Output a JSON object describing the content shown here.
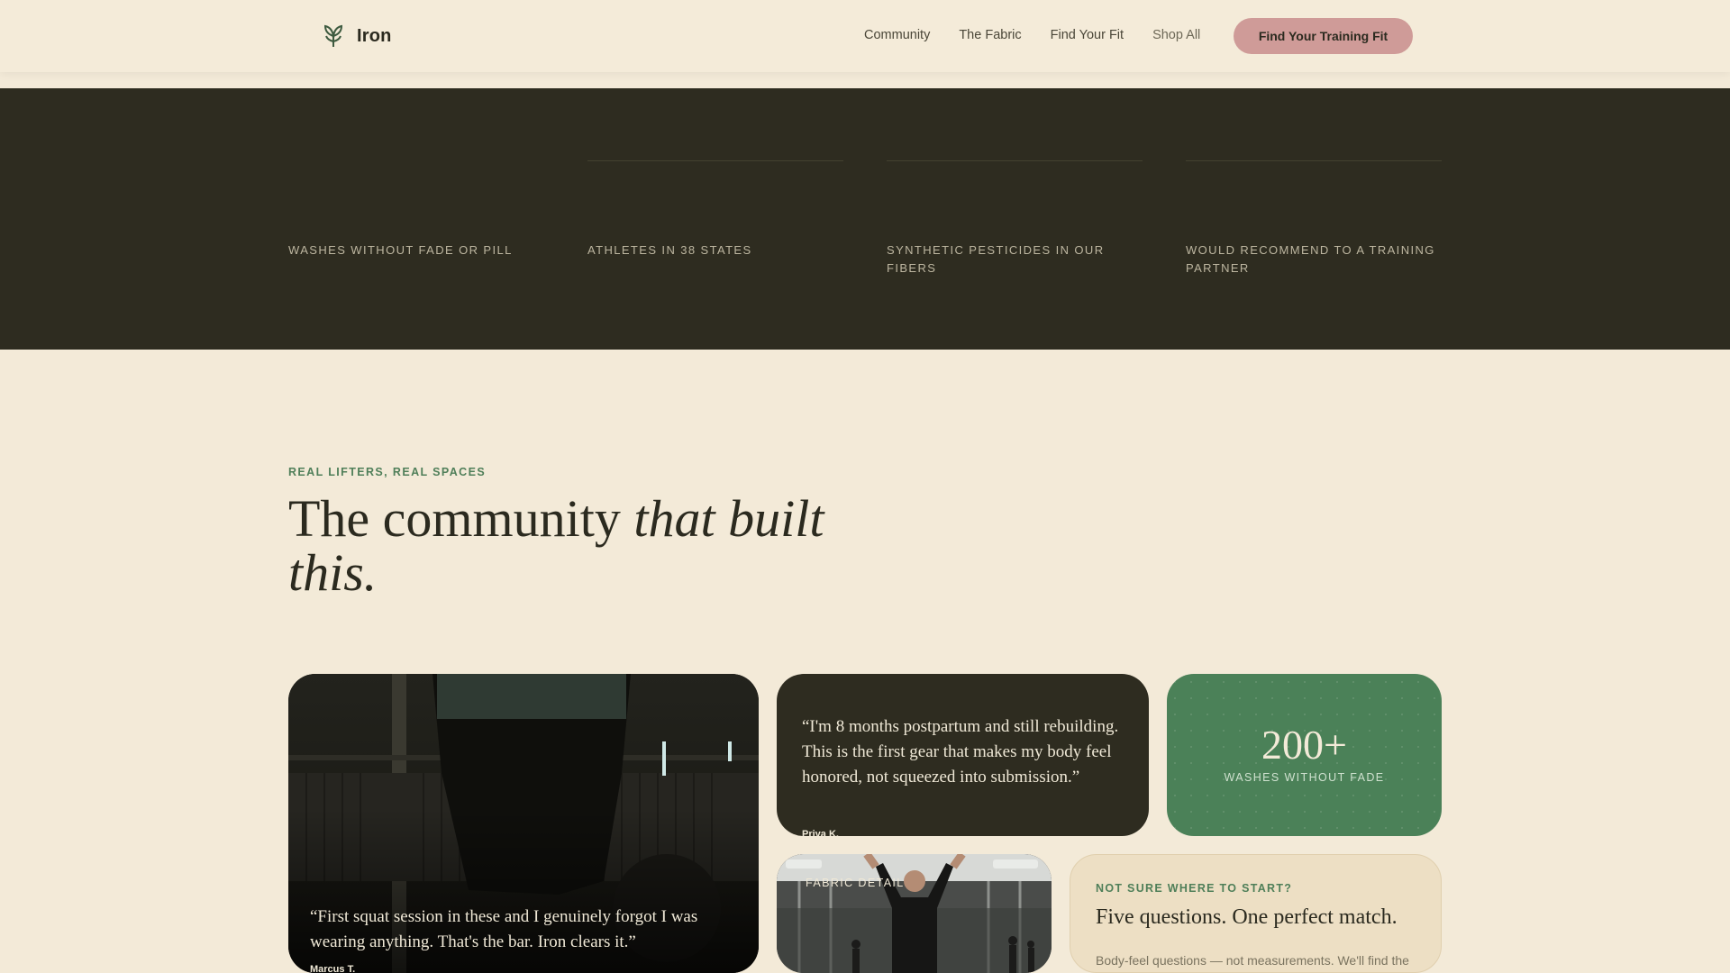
{
  "nav": {
    "brand": "Iron",
    "links": [
      "Community",
      "The Fabric",
      "Find Your Fit",
      "Shop All"
    ],
    "cta": "Find Your Training Fit"
  },
  "stats_band": {
    "items": [
      {
        "label": "WASHES WITHOUT FADE OR PILL"
      },
      {
        "label": "ATHLETES IN 38 STATES"
      },
      {
        "label": "SYNTHETIC PESTICIDES IN OUR FIBERS"
      },
      {
        "label": "WOULD RECOMMEND TO A TRAINING PARTNER"
      }
    ]
  },
  "community": {
    "eyebrow": "REAL LIFTERS, REAL SPACES",
    "headline_plain": "The community ",
    "headline_italic": "that built this."
  },
  "cards": {
    "photo_quote": {
      "quote": "“First squat session in these and I genuinely forgot I was wearing anything. That's the bar. Iron clears it.”",
      "author": "Marcus T."
    },
    "text_quote": {
      "quote": "“I'm 8 months postpartum and still rebuilding. This is the first gear that makes my body feel honored, not squeezed into submission.”",
      "author": "Priya K."
    },
    "stat": {
      "value": "200+",
      "label": "WASHES WITHOUT FADE"
    },
    "fabric": {
      "tag": "FABRIC DETAIL"
    },
    "quiz": {
      "eyebrow": "NOT SURE WHERE TO START?",
      "title": "Five questions. One perfect match.",
      "body": "Body-feel questions — not measurements. We'll find the"
    }
  },
  "colors": {
    "background": "#f3ead8",
    "dark": "#2e2c20",
    "accent_green": "#4b8158",
    "cta_pink": "#cf9b98"
  },
  "icons": {
    "brand_logo": "leaf-sprout-icon"
  }
}
